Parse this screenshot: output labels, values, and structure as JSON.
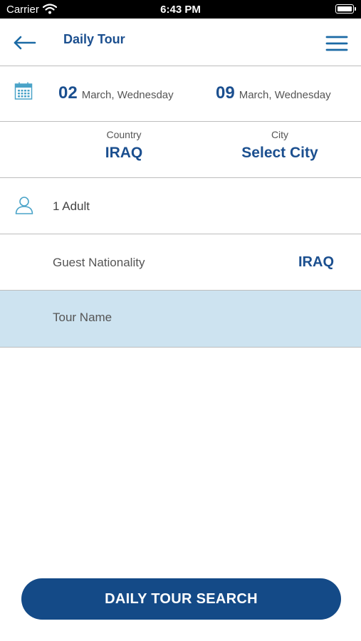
{
  "status_bar": {
    "carrier": "Carrier",
    "time": "6:43 PM"
  },
  "header": {
    "title": "Daily Tour"
  },
  "dates": {
    "start": {
      "day": "02",
      "label": "March, Wednesday"
    },
    "end": {
      "day": "09",
      "label": "March, Wednesday"
    }
  },
  "location": {
    "country_label": "Country",
    "country_value": "IRAQ",
    "city_label": "City",
    "city_value": "Select City"
  },
  "guests": {
    "label": "1 Adult"
  },
  "nationality": {
    "label": "Guest Nationality",
    "value": "IRAQ"
  },
  "tour": {
    "placeholder": "Tour Name"
  },
  "search_button": {
    "label": "DAILY TOUR SEARCH"
  },
  "colors": {
    "primary": "#1b4f8f",
    "button": "#144a87",
    "highlight": "#cde3f0",
    "icon": "#4aa3c8"
  },
  "icons": [
    "back-arrow-icon",
    "hamburger-menu-icon",
    "calendar-icon",
    "person-icon",
    "wifi-icon",
    "battery-icon"
  ]
}
